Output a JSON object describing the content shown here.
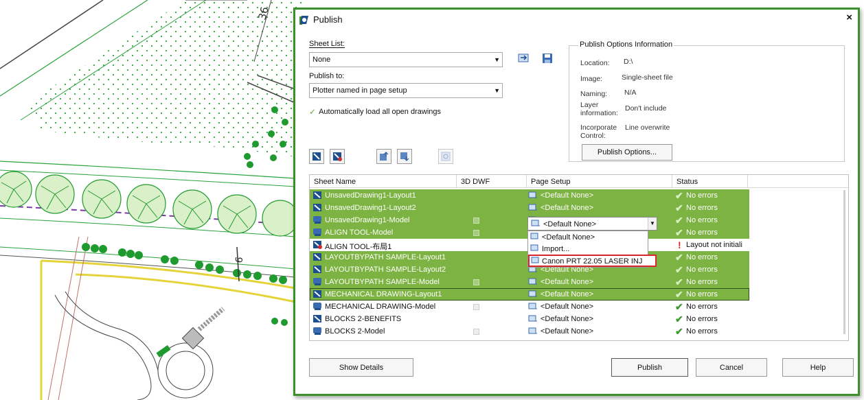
{
  "dialog": {
    "title": "Publish",
    "close": "×",
    "sheet_list_label": "Sheet List:",
    "sheet_list_value": "None",
    "publish_to_label": "Publish to:",
    "publish_to_value": "Plotter named in page setup",
    "auto_load_label": "Automatically load all open drawings",
    "auto_load_checked": true
  },
  "options_info": {
    "title": "Publish Options Information",
    "rows": [
      {
        "key": "Location:",
        "value": "D:\\"
      },
      {
        "key": "Image:",
        "value": "Single-sheet file"
      },
      {
        "key": "Naming:",
        "value": "N/A"
      },
      {
        "key": "Layer information:",
        "value": "Don't include"
      },
      {
        "key": "Incorporate Control:",
        "value": "Line overwrite"
      }
    ],
    "button": "Publish Options..."
  },
  "grid": {
    "headers": [
      "Sheet Name",
      "3D DWF",
      "Page Setup",
      "Status"
    ],
    "rows": [
      {
        "name": "UnsavedDrawing1-Layout1",
        "page_setup": "<Default None>",
        "status": "No errors",
        "selected": true,
        "type": "layout",
        "dwf": false,
        "status_icon": "check"
      },
      {
        "name": "UnsavedDrawing1-Layout2",
        "page_setup": "<Default None>",
        "status": "No errors",
        "selected": true,
        "type": "layout",
        "dwf": false,
        "status_icon": "check"
      },
      {
        "name": "UnsavedDrawing1-Model",
        "page_setup": "<Default None>",
        "status": "No errors",
        "selected": true,
        "type": "model",
        "dwf": true,
        "status_icon": "check"
      },
      {
        "name": "ALIGN TOOL-Model",
        "page_setup": "<Default None>",
        "status": "No errors",
        "selected": true,
        "type": "model",
        "dwf": true,
        "status_icon": "check"
      },
      {
        "name": "ALIGN TOOL-布局1",
        "page_setup": "<Default None>",
        "status": "Layout not initiali",
        "selected": false,
        "type": "layout-warn",
        "dwf": false,
        "status_icon": "warning"
      },
      {
        "name": "LAYOUTBYPATH SAMPLE-Layout1",
        "page_setup": "<Default None>",
        "status": "No errors",
        "selected": true,
        "type": "layout",
        "dwf": false,
        "status_icon": "check"
      },
      {
        "name": "LAYOUTBYPATH SAMPLE-Layout2",
        "page_setup": "<Default None>",
        "status": "No errors",
        "selected": true,
        "type": "layout",
        "dwf": false,
        "status_icon": "check"
      },
      {
        "name": "LAYOUTBYPATH SAMPLE-Model",
        "page_setup": "<Default None>",
        "status": "No errors",
        "selected": true,
        "type": "model",
        "dwf": true,
        "status_icon": "check"
      },
      {
        "name": "MECHANICAL DRAWING-Layout1",
        "page_setup": "<Default None>",
        "status": "No errors",
        "selected": true,
        "type": "layout",
        "dwf": false,
        "status_icon": "check",
        "focused": true
      },
      {
        "name": "MECHANICAL DRAWING-Model",
        "page_setup": "<Default None>",
        "status": "No errors",
        "selected": false,
        "type": "model",
        "dwf": true,
        "status_icon": "check"
      },
      {
        "name": "BLOCKS 2-BENEFITS",
        "page_setup": "<Default None>",
        "status": "No errors",
        "selected": false,
        "type": "layout",
        "dwf": false,
        "status_icon": "check"
      },
      {
        "name": "BLOCKS 2-Model",
        "page_setup": "<Default None>",
        "status": "No errors",
        "selected": false,
        "type": "model",
        "dwf": true,
        "status_icon": "check"
      }
    ]
  },
  "page_setup_dropdown": {
    "current": "<Default None>",
    "options": [
      "<Default None>",
      "Import...",
      "Canon PRT 22.05 LASER INJ"
    ],
    "highlighted": "Canon PRT 22.05 LASER INJ"
  },
  "buttons": {
    "show_details": "Show Details",
    "publish": "Publish",
    "cancel": "Cancel",
    "help": "Help"
  },
  "background": {
    "dimension_label": "36",
    "dimension_label_2": "6"
  },
  "colors": {
    "selection": "#7cb342",
    "dialog_border": "#3d8f2c",
    "highlight_box": "#d9262c",
    "check": "#3c9a2e",
    "cad_green": "#1f9a2e"
  }
}
